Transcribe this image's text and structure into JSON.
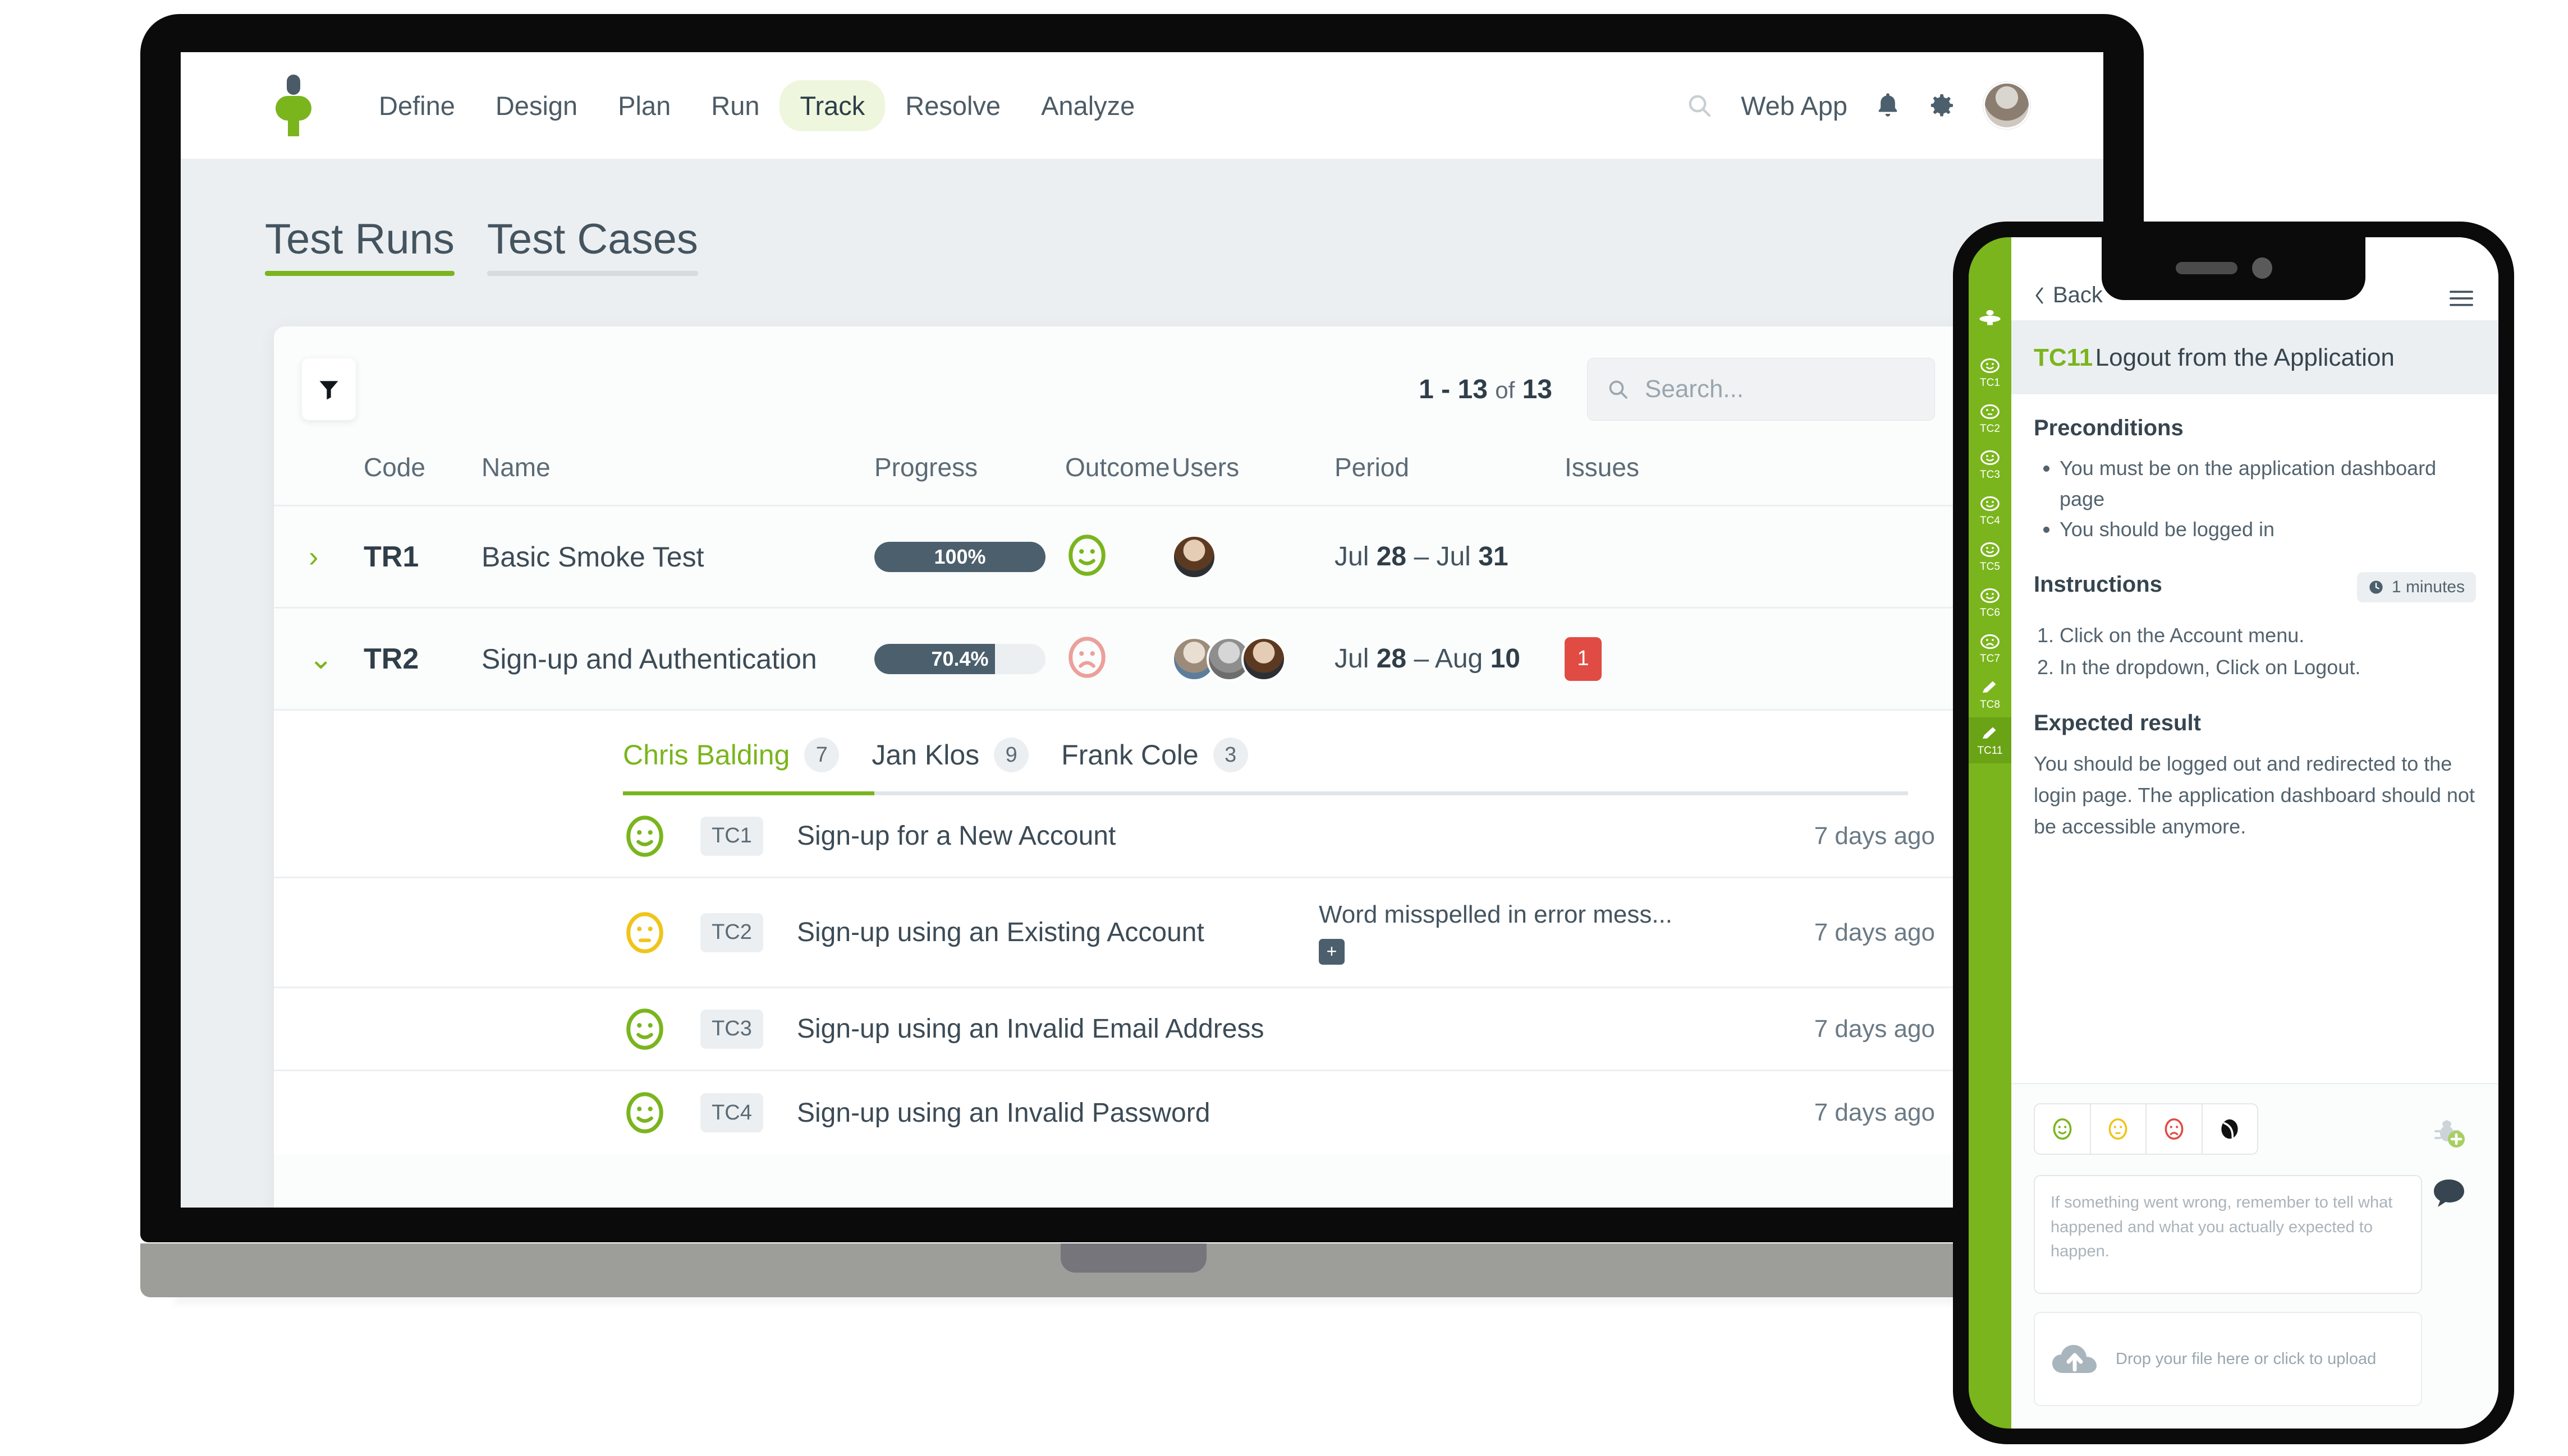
{
  "nav": {
    "brand_icon": "testmonitor-logo",
    "links": [
      {
        "label": "Define",
        "active": false
      },
      {
        "label": "Design",
        "active": false
      },
      {
        "label": "Plan",
        "active": false
      },
      {
        "label": "Run",
        "active": false
      },
      {
        "label": "Track",
        "active": true
      },
      {
        "label": "Resolve",
        "active": false
      },
      {
        "label": "Analyze",
        "active": false
      }
    ],
    "search_icon": "search-icon",
    "webapp_label": "Web App",
    "bell_icon": "bell-icon",
    "gear_icon": "gear-icon",
    "avatar": "user-avatar"
  },
  "page": {
    "tabs": [
      {
        "label": "Test Runs",
        "active": true
      },
      {
        "label": "Test Cases",
        "active": false
      }
    ]
  },
  "toolbar": {
    "filter_icon": "filter-icon",
    "pagination_range": "1 - 13",
    "pagination_of": "of",
    "pagination_total": "13",
    "search_placeholder": "Search...",
    "search_value": ""
  },
  "table": {
    "headers": [
      "Code",
      "Name",
      "Progress",
      "Outcome",
      "Users",
      "Period",
      "Issues"
    ],
    "rows": [
      {
        "caret": "›",
        "expanded": false,
        "code": "TR1",
        "name": "Basic Smoke Test",
        "progress_label": "100%",
        "progress_value": 100,
        "outcome": "passed",
        "users": 1,
        "period_from_mon": "Jul",
        "period_from_day": "28",
        "period_dash": "–",
        "period_to_mon": "Jul",
        "period_to_day": "31",
        "issues": ""
      },
      {
        "caret": "⌄",
        "expanded": true,
        "code": "TR2",
        "name": "Sign-up and Authentication",
        "progress_label": "70.4%",
        "progress_value": 70.4,
        "outcome": "failed",
        "users": 3,
        "period_from_mon": "Jul",
        "period_from_day": "28",
        "period_dash": "–",
        "period_to_mon": "Aug",
        "period_to_day": "10",
        "issues": "1"
      }
    ]
  },
  "subpanel": {
    "user_tabs": [
      {
        "name": "Chris Balding",
        "count": "7",
        "active": true
      },
      {
        "name": "Jan Klos",
        "count": "9",
        "active": false
      },
      {
        "name": "Frank Cole",
        "count": "3",
        "active": false
      }
    ],
    "cases": [
      {
        "outcome": "passed",
        "code": "TC1",
        "name": "Sign-up for a New Account",
        "issue": "",
        "time": "7 days ago"
      },
      {
        "outcome": "caution",
        "code": "TC2",
        "name": "Sign-up using an Existing Account",
        "issue": "Word misspelled in error mess...",
        "issue_add": "+",
        "time": "7 days ago"
      },
      {
        "outcome": "passed",
        "code": "TC3",
        "name": "Sign-up using an Invalid Email Address",
        "issue": "",
        "time": "7 days ago"
      },
      {
        "outcome": "passed",
        "code": "TC4",
        "name": "Sign-up using an Invalid Password",
        "issue": "",
        "time": "7 days ago"
      }
    ]
  },
  "phone": {
    "back_label": "Back",
    "back_icon": "chevron-left-icon",
    "menu_icon": "hamburger-menu-icon",
    "rail": {
      "logo_icon": "testmonitor-logo",
      "items": [
        {
          "label": "TC1",
          "icon": "smiley-pass-icon",
          "active": false
        },
        {
          "label": "TC2",
          "icon": "smiley-caution-icon",
          "active": false
        },
        {
          "label": "TC3",
          "icon": "smiley-pass-icon",
          "active": false
        },
        {
          "label": "TC4",
          "icon": "smiley-pass-icon",
          "active": false
        },
        {
          "label": "TC5",
          "icon": "smiley-pass-icon",
          "active": false
        },
        {
          "label": "TC6",
          "icon": "smiley-pass-icon",
          "active": false
        },
        {
          "label": "TC7",
          "icon": "smiley-fail-icon",
          "active": false
        },
        {
          "label": "TC8",
          "icon": "pencil-icon",
          "active": false
        },
        {
          "label": "TC11",
          "icon": "pencil-icon",
          "active": true
        }
      ]
    },
    "title_code": "TC11",
    "title_name": "Logout from the Application",
    "preconditions_heading": "Preconditions",
    "preconditions": [
      "You must be on the application dashboard page",
      "You should be logged in"
    ],
    "instructions_heading": "Instructions",
    "duration_badge": "1 minutes",
    "duration_icon": "clock-icon",
    "instructions": [
      "Click on the Account menu.",
      "In the dropdown, Click on Logout."
    ],
    "expected_heading": "Expected result",
    "expected_text": "You should be logged out and redirected to the login page. The application dashboard should not be accessible anymore.",
    "outcome_buttons": [
      {
        "name": "pass",
        "icon": "smiley-pass-icon"
      },
      {
        "name": "caution",
        "icon": "smiley-caution-icon"
      },
      {
        "name": "fail",
        "icon": "smiley-fail-icon"
      },
      {
        "name": "blocked",
        "icon": "smiley-blocked-icon"
      }
    ],
    "comment_placeholder": "If something went wrong, remember to tell what happened and what you actually expected to happen.",
    "upload_text": "Drop your file here or click to upload",
    "upload_icon": "cloud-upload-icon",
    "side_buttons": [
      {
        "name": "add-issue",
        "icon": "bug-plus-icon"
      },
      {
        "name": "comments",
        "icon": "comment-bubble-icon"
      }
    ]
  },
  "colors": {
    "brand_green": "#7ab51d",
    "pass_green": "#7ab51d",
    "caution_yellow": "#f0c419",
    "fail_red": "#e04b43",
    "ink": "#36454f",
    "slate": "#4c5f6d",
    "panel_bg": "#eceff1"
  }
}
